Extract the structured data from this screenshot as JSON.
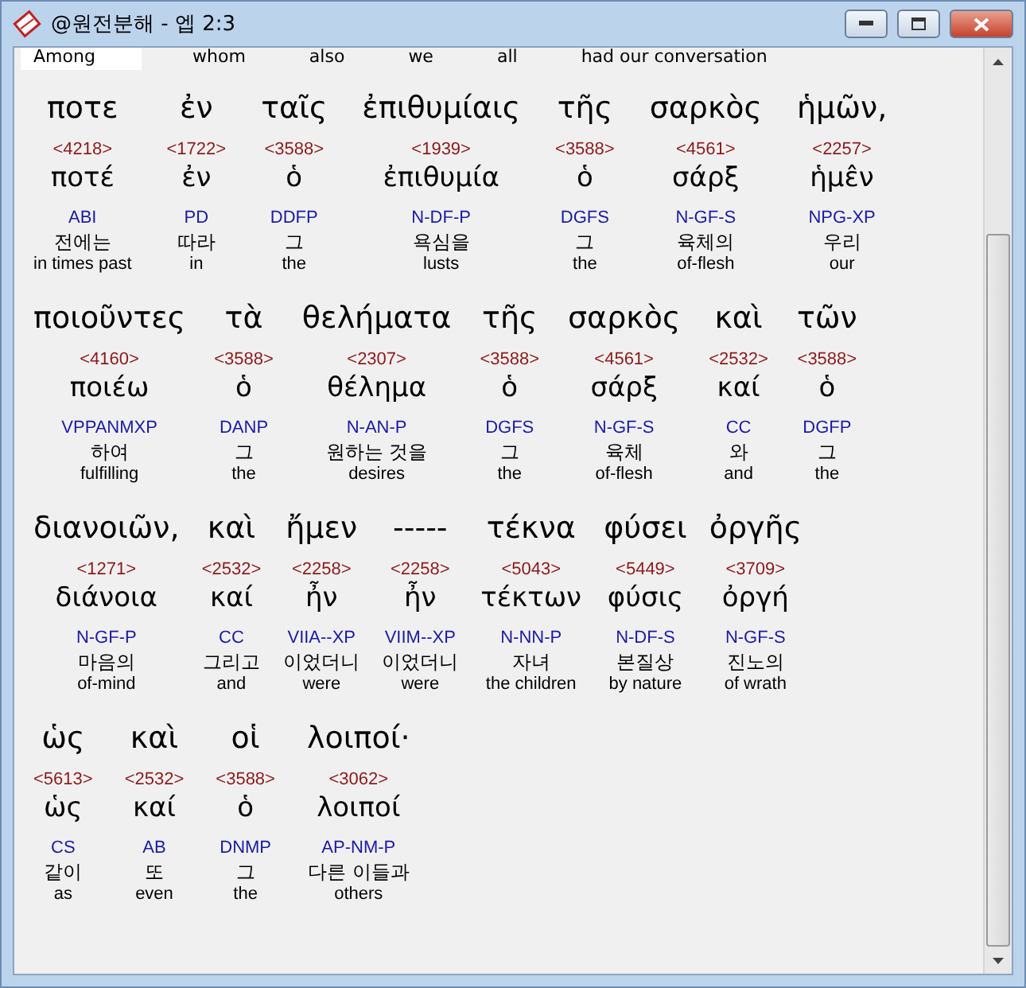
{
  "window": {
    "title": "@원전분해 - 엡 2:3"
  },
  "header_words": [
    {
      "text": "Among",
      "selected": true
    },
    {
      "text": "whom",
      "selected": false
    },
    {
      "text": "also",
      "selected": false
    },
    {
      "text": "we",
      "selected": false
    },
    {
      "text": "all",
      "selected": false
    },
    {
      "text": "had our conversation",
      "selected": false
    }
  ],
  "lines": [
    {
      "words": [
        {
          "greek": "ποτε",
          "strong": "<4218>",
          "lemma": "ποτέ",
          "parse": "ABI",
          "korean": "전에는",
          "english": "in times past"
        },
        {
          "greek": "ἐν",
          "strong": "<1722>",
          "lemma": "ἐν",
          "parse": "PD",
          "korean": "따라",
          "english": "in"
        },
        {
          "greek": "ταῖς",
          "strong": "<3588>",
          "lemma": "ὁ",
          "parse": "DDFP",
          "korean": "그",
          "english": "the"
        },
        {
          "greek": "ἐπιθυμίαις",
          "strong": "<1939>",
          "lemma": "ἐπιθυμία",
          "parse": "N-DF-P",
          "korean": "욕심을",
          "english": "lusts"
        },
        {
          "greek": "τῆς",
          "strong": "<3588>",
          "lemma": "ὁ",
          "parse": "DGFS",
          "korean": "그",
          "english": "the"
        },
        {
          "greek": "σαρκὸς",
          "strong": "<4561>",
          "lemma": "σάρξ",
          "parse": "N-GF-S",
          "korean": "육체의",
          "english": "of-flesh"
        },
        {
          "greek": "ἡμῶν,",
          "strong": "<2257>",
          "lemma": "ἡμε̂ν",
          "parse": "NPG-XP",
          "korean": "우리",
          "english": "our"
        }
      ]
    },
    {
      "words": [
        {
          "greek": "ποιοῦντες",
          "strong": "<4160>",
          "lemma": "ποιέω",
          "parse": "VPPANMXP",
          "korean": "하여",
          "english": "fulfilling"
        },
        {
          "greek": "τὰ",
          "strong": "<3588>",
          "lemma": "ὁ",
          "parse": "DANP",
          "korean": "그",
          "english": "the"
        },
        {
          "greek": "θελήματα",
          "strong": "<2307>",
          "lemma": "θέλημα",
          "parse": "N-AN-P",
          "korean": "원하는 것을",
          "english": "desires"
        },
        {
          "greek": "τῆς",
          "strong": "<3588>",
          "lemma": "ὁ",
          "parse": "DGFS",
          "korean": "그",
          "english": "the"
        },
        {
          "greek": "σαρκὸς",
          "strong": "<4561>",
          "lemma": "σάρξ",
          "parse": "N-GF-S",
          "korean": "육체",
          "english": "of-flesh"
        },
        {
          "greek": "καὶ",
          "strong": "<2532>",
          "lemma": "καί",
          "parse": "CC",
          "korean": "와",
          "english": "and"
        },
        {
          "greek": "τῶν",
          "strong": "<3588>",
          "lemma": "ὁ",
          "parse": "DGFP",
          "korean": "그",
          "english": "the"
        }
      ]
    },
    {
      "words": [
        {
          "greek": "διανοιῶν,",
          "strong": "<1271>",
          "lemma": "διάνοια",
          "parse": "N-GF-P",
          "korean": "마음의",
          "english": "of-mind"
        },
        {
          "greek": "καὶ",
          "strong": "<2532>",
          "lemma": "καί",
          "parse": "CC",
          "korean": "그리고",
          "english": "and"
        },
        {
          "greek": "ἤμεν",
          "strong": "<2258>",
          "lemma": "ἦν",
          "parse": "VIIA--XP",
          "korean": "이었더니",
          "english": "were"
        },
        {
          "greek": "-----",
          "strong": "<2258>",
          "lemma": "ἦν",
          "parse": "VIIM--XP",
          "korean": "이었더니",
          "english": "were"
        },
        {
          "greek": "τέκνα",
          "strong": "<5043>",
          "lemma": "τέκτων",
          "parse": "N-NN-P",
          "korean": "자녀",
          "english": "the children"
        },
        {
          "greek": "φύσει",
          "strong": "<5449>",
          "lemma": "φύσις",
          "parse": "N-DF-S",
          "korean": "본질상",
          "english": "by nature"
        },
        {
          "greek": "ὀργῆς",
          "strong": "<3709>",
          "lemma": "ὀργή",
          "parse": "N-GF-S",
          "korean": "진노의",
          "english": "of wrath"
        }
      ]
    },
    {
      "words": [
        {
          "greek": "ὡς",
          "strong": "<5613>",
          "lemma": "ὡς",
          "parse": "CS",
          "korean": "같이",
          "english": "as"
        },
        {
          "greek": "καὶ",
          "strong": "<2532>",
          "lemma": "καί",
          "parse": "AB",
          "korean": "또",
          "english": "even"
        },
        {
          "greek": "οἱ",
          "strong": "<3588>",
          "lemma": "ὁ",
          "parse": "DNMP",
          "korean": "그",
          "english": "the"
        },
        {
          "greek": "λοιποί·",
          "strong": "<3062>",
          "lemma": "λοιποί",
          "parse": "AP-NM-P",
          "korean": "다른 이들과",
          "english": "others"
        }
      ]
    }
  ]
}
